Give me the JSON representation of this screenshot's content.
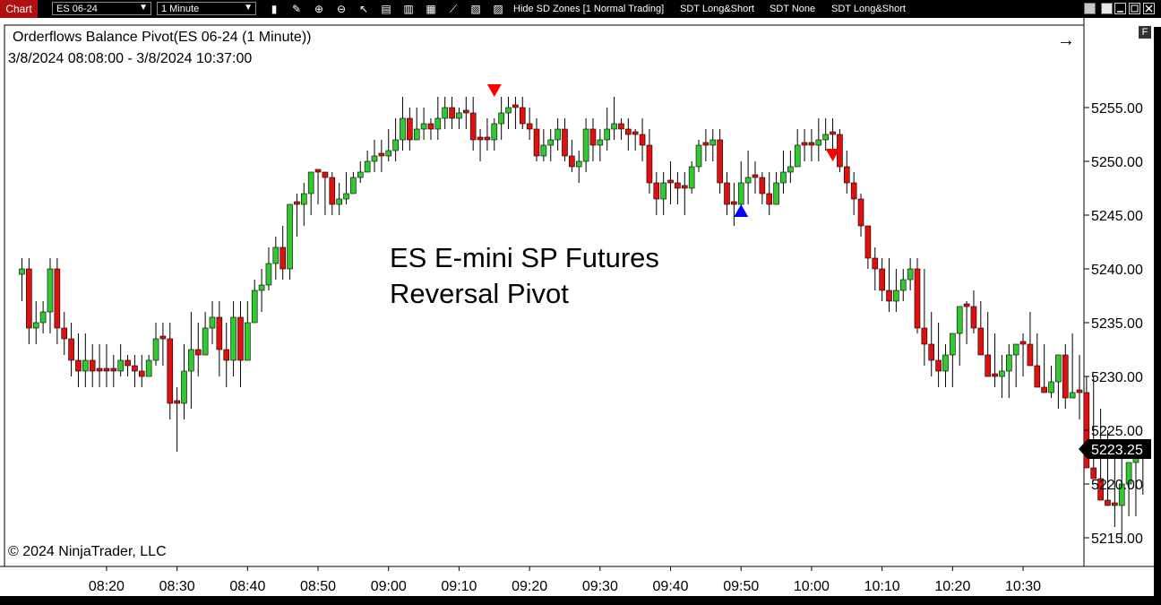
{
  "toolbar": {
    "chart_tab": "Chart",
    "instrument": "ES 06-24",
    "interval": "1 Minute",
    "icons": [
      "bar-type-icon",
      "pencil-icon",
      "zoom-in-icon",
      "zoom-out-icon",
      "pointer-icon",
      "data-box-icon",
      "properties-icon",
      "strategies-icon",
      "drawing-tools-icon",
      "indicators-icon",
      "templates-icon"
    ],
    "buttons": [
      "Hide SD Zones [1 Normal Trading]",
      "SDT Long&Short",
      "SDT None",
      "SDT Long&Short"
    ]
  },
  "chart": {
    "title": "Orderflows Balance Pivot(ES 06-24 (1 Minute))",
    "date_range": "3/8/2024 08:08:00 - 3/8/2024 10:37:00",
    "annotation_line1": "ES E-mini SP Futures",
    "annotation_line2": "Reversal Pivot",
    "copyright": "© 2024 NinjaTrader, LLC",
    "last_price_label": "5223.25",
    "f_badge": "F",
    "arrow_glyph": "→",
    "colors": {
      "up": "#32c832",
      "down": "#e01010",
      "wick": "#000000",
      "signal_down": "#ff0000",
      "signal_up": "#0000ff",
      "last_price_bg": "#000000"
    }
  },
  "chart_data": {
    "type": "candlestick",
    "y_ticks": [
      "5255.00",
      "5250.00",
      "5245.00",
      "5240.00",
      "5235.00",
      "5230.00",
      "5225.00",
      "5220.00",
      "5215.00"
    ],
    "y_tick_values": [
      5255,
      5250,
      5245,
      5240,
      5235,
      5230,
      5225,
      5220,
      5215
    ],
    "x_ticks": [
      "08:20",
      "08:30",
      "08:40",
      "08:50",
      "09:00",
      "09:10",
      "09:20",
      "09:30",
      "09:40",
      "09:50",
      "10:00",
      "10:10",
      "10:20",
      "10:30"
    ],
    "x_tick_minutes": [
      500,
      510,
      520,
      530,
      540,
      550,
      560,
      570,
      580,
      590,
      600,
      610,
      620,
      630
    ],
    "start_minute": 488,
    "last_price": 5223.25,
    "closes": [
      5240,
      5234.5,
      5235,
      5236,
      5240,
      5234.5,
      5233.5,
      5231.5,
      5230.5,
      5231.5,
      5230.5,
      5230.5,
      5230.5,
      5230.5,
      5231.5,
      5231,
      5230.5,
      5230,
      5231.5,
      5233.5,
      5233.5,
      5227.5,
      5227.5,
      5230.5,
      5232.5,
      5232,
      5234.5,
      5235.5,
      5232.5,
      5231.5,
      5235.5,
      5231.5,
      5235,
      5238,
      5238.5,
      5240.5,
      5242,
      5240,
      5246,
      5246,
      5247,
      5249,
      5249,
      5248.5,
      5246,
      5246.5,
      5247,
      5248.5,
      5249,
      5250,
      5250.5,
      5250.5,
      5251,
      5252,
      5254,
      5252,
      5253,
      5253.5,
      5253,
      5254,
      5255,
      5254,
      5254.5,
      5254.5,
      5252,
      5252,
      5252,
      5253.5,
      5254.5,
      5255,
      5255,
      5253.5,
      5253,
      5250.5,
      5251.5,
      5252,
      5253,
      5250.5,
      5249.5,
      5250,
      5253,
      5251.5,
      5252,
      5253,
      5253.5,
      5253,
      5252.5,
      5252.5,
      5251.5,
      5248,
      5246.5,
      5248,
      5248,
      5247.5,
      5247.5,
      5249.5,
      5251.5,
      5251.5,
      5252,
      5248,
      5246,
      5246,
      5248,
      5248.5,
      5248.5,
      5247,
      5246,
      5248,
      5249,
      5249.5,
      5251.5,
      5251.5,
      5251.5,
      5252,
      5252.5,
      5252.5,
      5249.5,
      5248,
      5246.5,
      5244,
      5241,
      5240,
      5238,
      5237,
      5238,
      5239,
      5240,
      5234.5,
      5233,
      5231.5,
      5230.5,
      5232,
      5234,
      5236.5,
      5236.5,
      5234.5,
      5232,
      5230,
      5230,
      5230.5,
      5232,
      5233,
      5233,
      5231,
      5229,
      5228.5,
      5229.5,
      5232,
      5228,
      5228.5,
      5228.5,
      5221.5,
      5220.5,
      5218.5,
      5218,
      5218,
      5220,
      5222,
      5223,
      5223.25
    ],
    "highs": [
      5241,
      5241,
      5237,
      5237,
      5241,
      5241,
      5236,
      5235,
      5234,
      5234,
      5233,
      5233,
      5233,
      5232,
      5233,
      5232,
      5232,
      5232,
      5232,
      5235,
      5235,
      5235,
      5229,
      5233,
      5236,
      5235,
      5236,
      5237,
      5237,
      5235,
      5237,
      5237,
      5237,
      5239,
      5240,
      5242,
      5243,
      5244,
      5246,
      5247,
      5248,
      5249,
      5249,
      5249,
      5249,
      5248,
      5249,
      5249,
      5250,
      5251,
      5252,
      5252,
      5253,
      5254,
      5256,
      5255,
      5255,
      5255,
      5254,
      5256,
      5256,
      5256,
      5255,
      5256,
      5256,
      5253,
      5254,
      5254,
      5256,
      5256,
      5256,
      5256,
      5255,
      5254,
      5253,
      5253,
      5254,
      5254,
      5252,
      5251,
      5254,
      5254,
      5253,
      5255,
      5256,
      5254,
      5254,
      5253,
      5254,
      5253,
      5249,
      5249,
      5250,
      5249,
      5249,
      5250,
      5252,
      5253,
      5253,
      5253,
      5249,
      5248,
      5250,
      5251,
      5250,
      5249,
      5249,
      5249,
      5251,
      5251,
      5253,
      5253,
      5253,
      5254,
      5254,
      5254,
      5253,
      5251,
      5249,
      5247,
      5244,
      5242,
      5241,
      5241,
      5240,
      5240,
      5241,
      5241,
      5240,
      5236,
      5235,
      5233,
      5233,
      5235,
      5237,
      5238,
      5237,
      5236,
      5234,
      5232,
      5233,
      5233,
      5234,
      5236,
      5234,
      5233,
      5231,
      5231,
      5233,
      5234,
      5232,
      5230,
      5230,
      5227,
      5225,
      5223,
      5224,
      5222,
      5221,
      5223,
      5224,
      5224,
      5224
    ],
    "lows": [
      5237,
      5233,
      5233,
      5234,
      5234,
      5233,
      5232,
      5230,
      5229,
      5229,
      5229,
      5229,
      5229,
      5229,
      5230,
      5230,
      5229,
      5229,
      5230,
      5231,
      5231,
      5226,
      5223,
      5226,
      5227,
      5230,
      5232,
      5233,
      5230,
      5229,
      5230,
      5229,
      5233,
      5235,
      5236,
      5238,
      5239,
      5239,
      5239,
      5243,
      5244,
      5245,
      5246,
      5245,
      5245,
      5245,
      5246,
      5247,
      5248,
      5249,
      5249,
      5249,
      5250,
      5250,
      5251,
      5251,
      5252,
      5252,
      5252,
      5252,
      5253,
      5253,
      5253,
      5253,
      5251,
      5250,
      5251,
      5251,
      5252,
      5253,
      5253,
      5253,
      5252,
      5250,
      5250,
      5250,
      5251,
      5250,
      5249,
      5248,
      5249,
      5250,
      5250,
      5251,
      5252,
      5252,
      5251,
      5251,
      5250,
      5247,
      5245,
      5245,
      5246,
      5246,
      5245,
      5247,
      5249,
      5250,
      5250,
      5247,
      5245,
      5244,
      5245,
      5246,
      5247,
      5246,
      5245,
      5246,
      5247,
      5248,
      5250,
      5250,
      5250,
      5250,
      5251,
      5251,
      5249,
      5247,
      5245,
      5243,
      5240,
      5238,
      5237,
      5236,
      5236,
      5237,
      5238,
      5234,
      5231,
      5230,
      5229,
      5229,
      5229,
      5231,
      5233,
      5234,
      5233,
      5231,
      5229,
      5228,
      5228,
      5229,
      5230,
      5231,
      5231,
      5229,
      5228,
      5227,
      5227,
      5228,
      5226,
      5226,
      5222,
      5220,
      5218,
      5216,
      5214.5,
      5217,
      5217,
      5219,
      5220,
      5221,
      5221
    ],
    "signals": [
      {
        "type": "down",
        "index": 67,
        "price": 5256.5
      },
      {
        "type": "up",
        "index": 102,
        "price": 5245.5
      },
      {
        "type": "down",
        "index": 115,
        "price": 5250.5
      }
    ]
  }
}
